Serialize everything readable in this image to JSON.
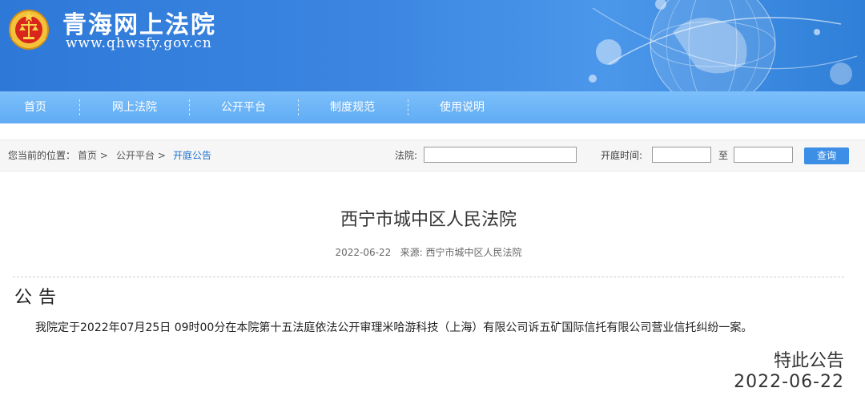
{
  "header": {
    "site_title": "青海网上法院",
    "site_url": "www.qhwsfy.gov.cn"
  },
  "nav": {
    "items": [
      "首页",
      "网上法院",
      "公开平台",
      "制度规范",
      "使用说明"
    ]
  },
  "breadcrumb": {
    "prefix": "您当前的位置：",
    "items": [
      "首页 >",
      "公开平台 >",
      "开庭公告"
    ]
  },
  "search": {
    "court_label": "法院:",
    "court_value": "",
    "time_label": "开庭时间:",
    "from_value": "",
    "to_label": "至",
    "to_value": "",
    "query_button": "查询"
  },
  "article": {
    "title": "西宁市城中区人民法院",
    "date": "2022-06-22",
    "source": "来源: 西宁市城中区人民法院",
    "notice_heading": "公告",
    "body": "我院定于2022年07月25日 09时00分在本院第十五法庭依法公开审理米哈游科技（上海）有限公司诉五矿国际信托有限公司营业信托纠纷一案。",
    "closing": "特此公告",
    "closing_date": "2022-06-22"
  },
  "colors": {
    "banner": "#3d87e2",
    "nav": "#6cb5f7",
    "accent": "#1d72cf",
    "button": "#3c8ee6"
  }
}
